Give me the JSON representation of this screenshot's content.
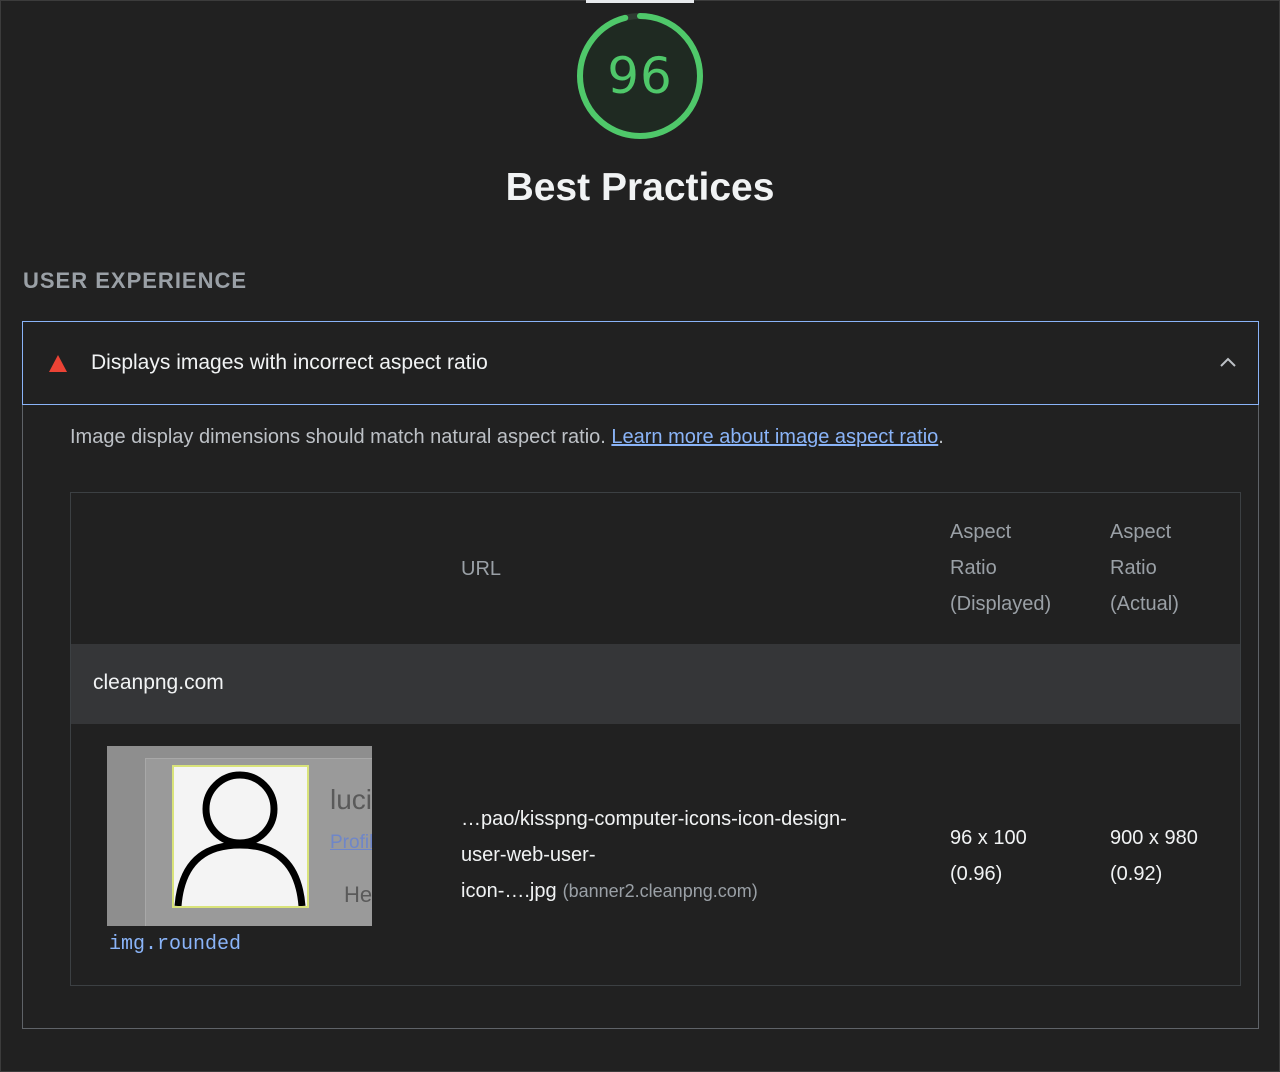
{
  "gauge": {
    "score": "96",
    "score_fraction": 0.96,
    "color": "#4fc86a"
  },
  "category": {
    "title": "Best Practices"
  },
  "group": {
    "title": "USER EXPERIENCE"
  },
  "audit": {
    "status_icon": "fail-triangle-icon",
    "status_color": "#eb4335",
    "title": "Displays images with incorrect aspect ratio",
    "description": "Image display dimensions should match natural aspect ratio.",
    "learn_more": "Learn more about image aspect ratio",
    "description_end": ".",
    "toggle_icon": "chevron-up-icon"
  },
  "table": {
    "headers": {
      "url": "URL",
      "displayed": [
        "Aspect",
        "Ratio",
        "(Displayed)"
      ],
      "actual": [
        "Aspect",
        "Ratio",
        "(Actual)"
      ]
    },
    "groups": [
      {
        "label": "cleanpng.com",
        "rows": [
          {
            "thumbnail_text": [
              "luci",
              "Profil",
              "He"
            ],
            "node": "img.rounded",
            "url_lines": [
              "…pao/kisspng-computer-icons-icon-design-",
              "user-web-user-",
              "icon-….jpg"
            ],
            "url_host": "(banner2.cleanpng.com)",
            "displayed": [
              "96 x 100",
              "(0.96)"
            ],
            "actual": [
              "900 x 980",
              "(0.92)"
            ]
          }
        ]
      }
    ]
  }
}
